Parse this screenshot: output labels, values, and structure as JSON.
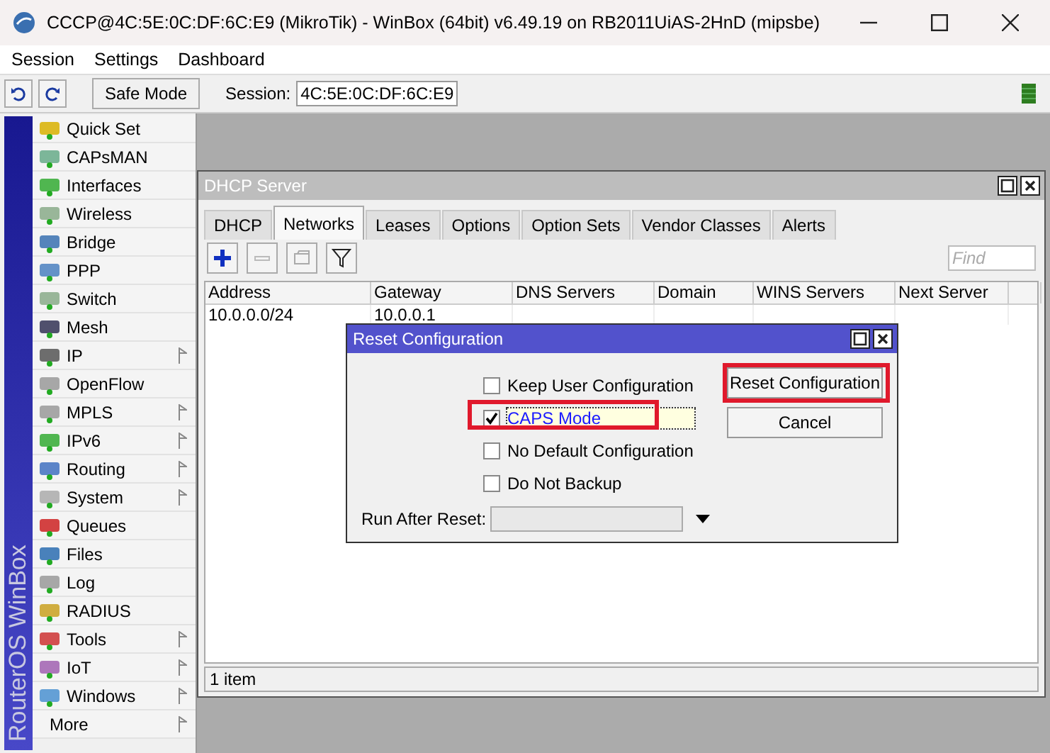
{
  "window": {
    "title": "CCCP@4C:5E:0C:DF:6C:E9 (MikroTik) - WinBox (64bit) v6.49.19 on RB2011UiAS-2HnD (mipsbe)"
  },
  "menu": [
    "Session",
    "Settings",
    "Dashboard"
  ],
  "toolbar": {
    "safe_mode": "Safe Mode",
    "session_label": "Session:",
    "session_value": "4C:5E:0C:DF:6C:E9"
  },
  "sidebar": {
    "brand": "RouterOS WinBox",
    "items": [
      {
        "label": "Quick Set",
        "submenu": false
      },
      {
        "label": "CAPsMAN",
        "submenu": false
      },
      {
        "label": "Interfaces",
        "submenu": false
      },
      {
        "label": "Wireless",
        "submenu": false
      },
      {
        "label": "Bridge",
        "submenu": false
      },
      {
        "label": "PPP",
        "submenu": false
      },
      {
        "label": "Switch",
        "submenu": false
      },
      {
        "label": "Mesh",
        "submenu": false
      },
      {
        "label": "IP",
        "submenu": true
      },
      {
        "label": "OpenFlow",
        "submenu": false
      },
      {
        "label": "MPLS",
        "submenu": true
      },
      {
        "label": "IPv6",
        "submenu": true
      },
      {
        "label": "Routing",
        "submenu": true
      },
      {
        "label": "System",
        "submenu": true
      },
      {
        "label": "Queues",
        "submenu": false
      },
      {
        "label": "Files",
        "submenu": false
      },
      {
        "label": "Log",
        "submenu": false
      },
      {
        "label": "RADIUS",
        "submenu": false
      },
      {
        "label": "Tools",
        "submenu": true
      },
      {
        "label": "IoT",
        "submenu": true
      },
      {
        "label": "Windows",
        "submenu": true
      },
      {
        "label": "More",
        "submenu": true
      }
    ]
  },
  "dhcp_window": {
    "title": "DHCP Server",
    "tabs": [
      {
        "label": "DHCP",
        "selected": false
      },
      {
        "label": "Networks",
        "selected": true
      },
      {
        "label": "Leases",
        "selected": false
      },
      {
        "label": "Options",
        "selected": false
      },
      {
        "label": "Option Sets",
        "selected": false
      },
      {
        "label": "Vendor Classes",
        "selected": false
      },
      {
        "label": "Alerts",
        "selected": false
      }
    ],
    "find_placeholder": "Find",
    "columns": [
      "Address",
      "Gateway",
      "DNS Servers",
      "Domain",
      "WINS Servers",
      "Next Server"
    ],
    "rows": [
      [
        "10.0.0.0/24",
        "10.0.0.1",
        "",
        "",
        "",
        ""
      ]
    ],
    "status": "1 item"
  },
  "dialog": {
    "title": "Reset Configuration",
    "options": [
      {
        "kind": "checkbox",
        "label": "Keep User Configuration",
        "checked": false,
        "focused": false,
        "highlighted": false
      },
      {
        "kind": "checkbox",
        "label": "CAPS Mode",
        "checked": true,
        "focused": true,
        "highlighted": true
      },
      {
        "kind": "checkbox",
        "label": "No Default Configuration",
        "checked": false,
        "focused": false,
        "highlighted": false
      },
      {
        "kind": "checkbox",
        "label": "Do Not Backup",
        "checked": false,
        "focused": false,
        "highlighted": false
      },
      {
        "kind": "dropdown",
        "label": "Run After Reset:"
      }
    ],
    "buttons": [
      {
        "label": "Reset Configuration",
        "highlighted": true
      },
      {
        "label": "Cancel",
        "highlighted": false
      }
    ]
  }
}
